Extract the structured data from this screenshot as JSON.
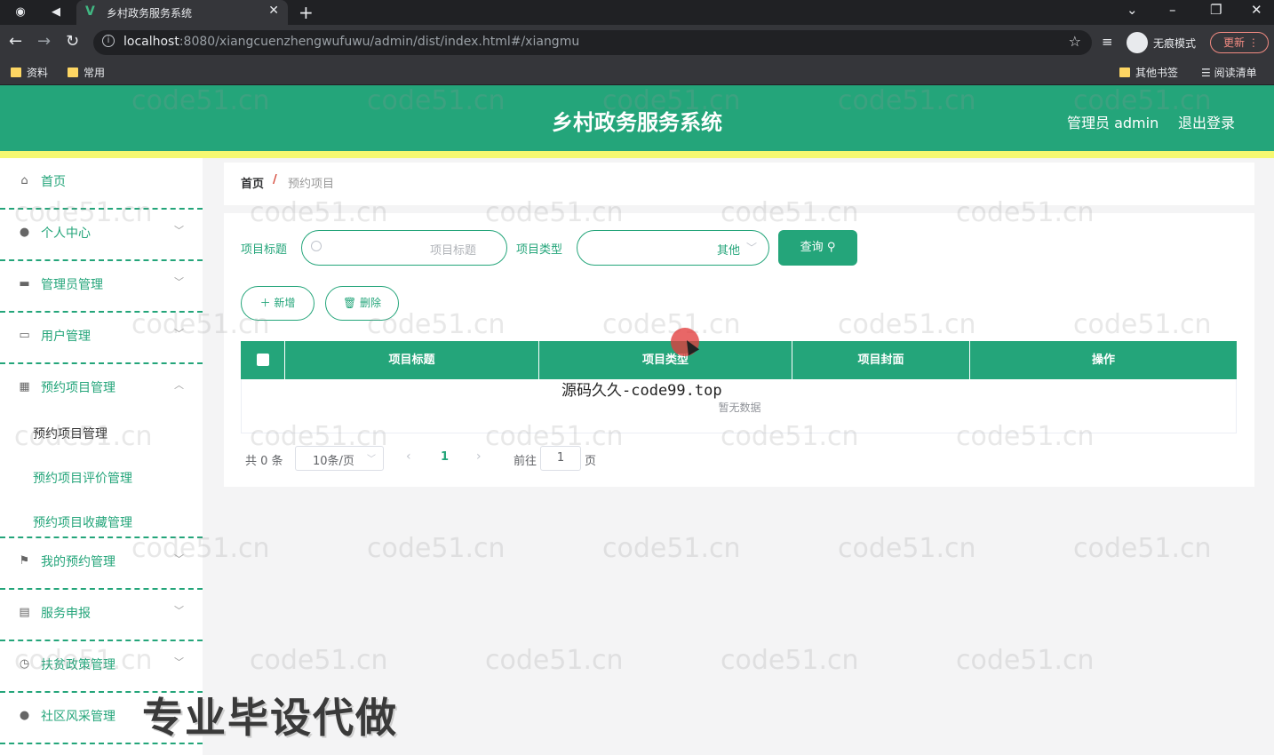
{
  "browser": {
    "tab_title": "乡村政务服务系统",
    "url_host": "localhost",
    "url_rest": ":8080/xiangcuenzhengwufuwu/admin/dist/index.html#/xiangmu",
    "incognito_label": "无痕模式",
    "update_label": "更新",
    "bookmarks_left": [
      "资料",
      "常用"
    ],
    "bookmark_other": "其他书签",
    "reading_list": "阅读清单"
  },
  "header": {
    "title": "乡村政务服务系统",
    "admin_label": "管理员 admin",
    "logout_label": "退出登录"
  },
  "sidebar": {
    "items": [
      {
        "label": "首页",
        "icon": "home-icon"
      },
      {
        "label": "个人中心",
        "icon": "user-icon"
      },
      {
        "label": "管理员管理",
        "icon": "briefcase-icon"
      },
      {
        "label": "用户管理",
        "icon": "chat-icon"
      },
      {
        "label": "预约项目管理",
        "icon": "grid-icon"
      },
      {
        "label": "我的预约管理",
        "icon": "flag-icon"
      },
      {
        "label": "服务申报",
        "icon": "message-icon"
      },
      {
        "label": "扶贫政策管理",
        "icon": "clock-icon"
      },
      {
        "label": "社区风采管理",
        "icon": "user-icon"
      }
    ],
    "sub_items": [
      "预约项目管理",
      "预约项目评价管理",
      "预约项目收藏管理"
    ]
  },
  "breadcrumb": {
    "home": "首页",
    "sep": "/",
    "current": "预约项目"
  },
  "search": {
    "title_label": "项目标题",
    "title_placeholder": "项目标题",
    "type_label": "项目类型",
    "type_value": "其他",
    "query_button": "查询"
  },
  "actions": {
    "add_label": "新增",
    "delete_label": "删除"
  },
  "table": {
    "columns": [
      "项目标题",
      "项目类型",
      "项目封面",
      "操作"
    ],
    "empty_text": "暂无数据"
  },
  "pagination": {
    "total_text": "共 0 条",
    "page_size": "10条/页",
    "current_page": "1",
    "goto_label": "前往",
    "goto_value": "1",
    "page_suffix": "页"
  },
  "overlays": {
    "watermark": "code51.cn",
    "source_mark": "源码久久-code99.top",
    "promo_text": "专业毕设代做"
  },
  "colors": {
    "primary": "#24a57a",
    "accent_bar": "#f5f871",
    "breadcrumb_sep": "#d64a3b"
  }
}
